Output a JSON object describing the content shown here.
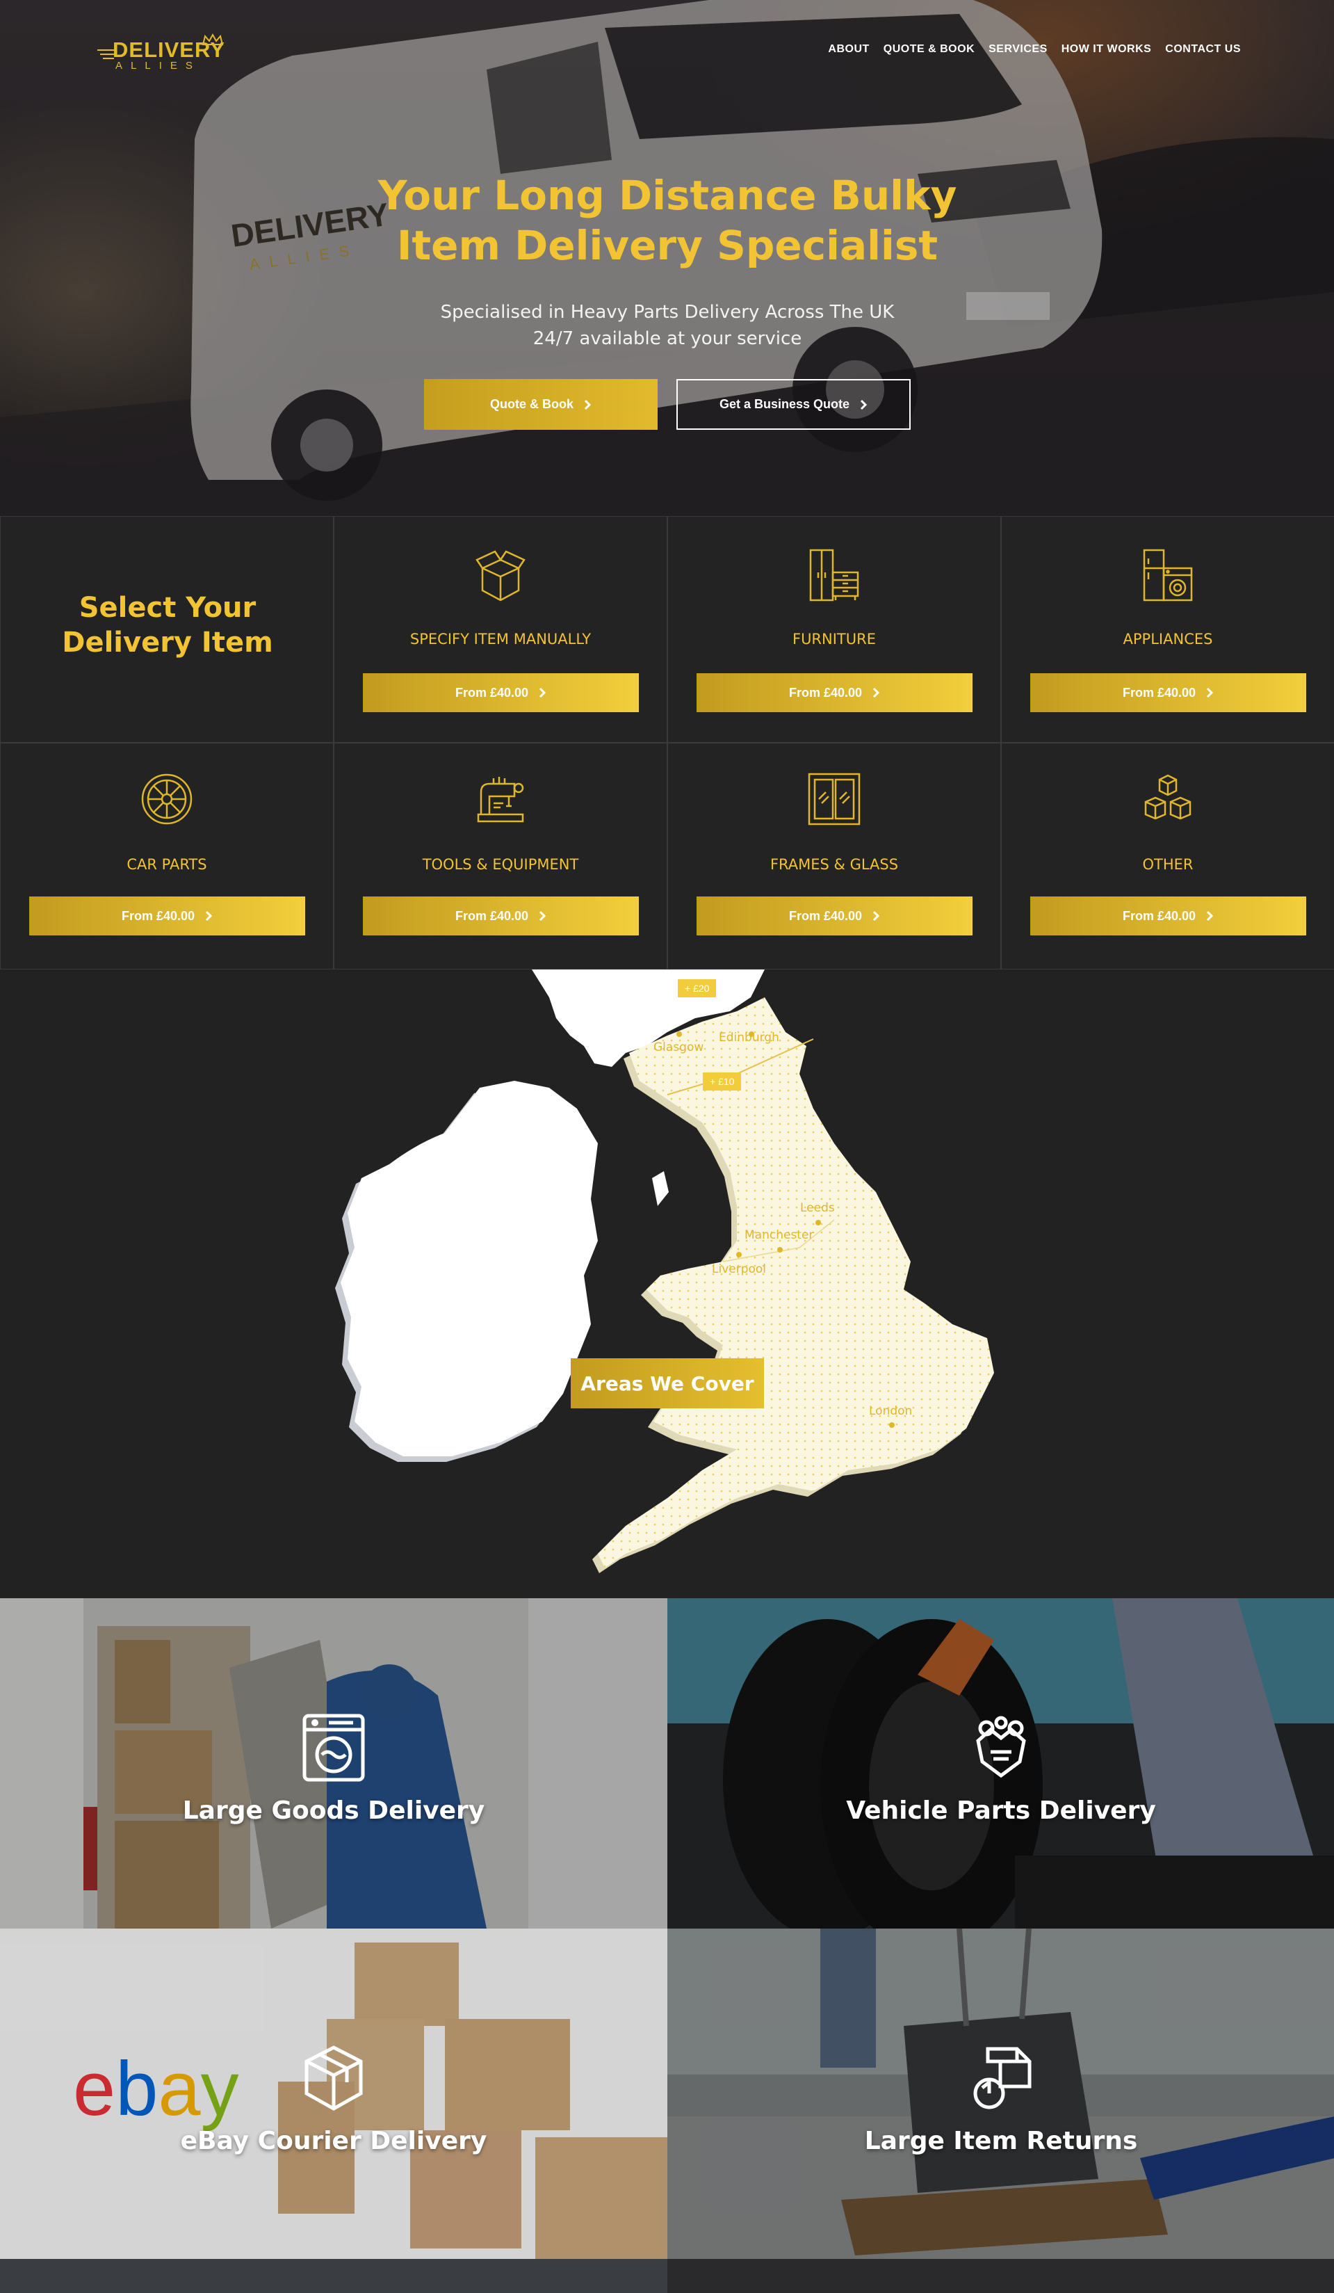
{
  "brand": {
    "logo_line1": "DELIVERY",
    "logo_line2": "ALLIES",
    "accent": "#f2c332",
    "accent_dark": "#c29b1f"
  },
  "nav": {
    "items": [
      "ABOUT",
      "QUOTE & BOOK",
      "SERVICES",
      "HOW IT WORKS",
      "CONTACT US"
    ]
  },
  "hero": {
    "title_line1": "Your Long Distance Bulky",
    "title_line2": "Item Delivery Specialist",
    "subtitle_line1": "Specialised in Heavy Parts Delivery Across The UK",
    "subtitle_line2": "24/7 available at your service",
    "primary_button": "Quote & Book",
    "secondary_button": "Get a Business Quote",
    "van_logo_line1": "DELIVERY",
    "van_logo_line2": "ALLIES"
  },
  "categories": {
    "heading": "Select Your Delivery Item",
    "items": [
      {
        "label": "SPECIFY ITEM MANUALLY",
        "price": "From £40.00",
        "icon": "open-box-icon"
      },
      {
        "label": "FURNITURE",
        "price": "From £40.00",
        "icon": "wardrobe-drawers-icon"
      },
      {
        "label": "APPLIANCES",
        "price": "From £40.00",
        "icon": "fridge-washer-icon"
      },
      {
        "label": "CAR PARTS",
        "price": "From £40.00",
        "icon": "wheel-rim-icon"
      },
      {
        "label": "TOOLS & EQUIPMENT",
        "price": "From £40.00",
        "icon": "sewing-machine-icon"
      },
      {
        "label": "FRAMES & GLASS",
        "price": "From £40.00",
        "icon": "glass-door-icon"
      },
      {
        "label": "OTHER",
        "price": "From £40.00",
        "icon": "stacked-boxes-icon"
      }
    ]
  },
  "map": {
    "button": "Areas We Cover",
    "badges": [
      "+ £20",
      "+ £10"
    ],
    "cities": [
      "Glasgow",
      "Edinburgh",
      "Leeds",
      "Manchester",
      "Liverpool",
      "London"
    ]
  },
  "services": [
    {
      "label": "Large Goods Delivery",
      "icon": "washing-machine-icon"
    },
    {
      "label": "Vehicle Parts Delivery",
      "icon": "engine-block-icon"
    },
    {
      "label": "eBay Courier Delivery",
      "icon": "parcel-box-icon"
    },
    {
      "label": "Large Item Returns",
      "icon": "return-box-icon"
    }
  ],
  "ebay_logo": "ebay"
}
